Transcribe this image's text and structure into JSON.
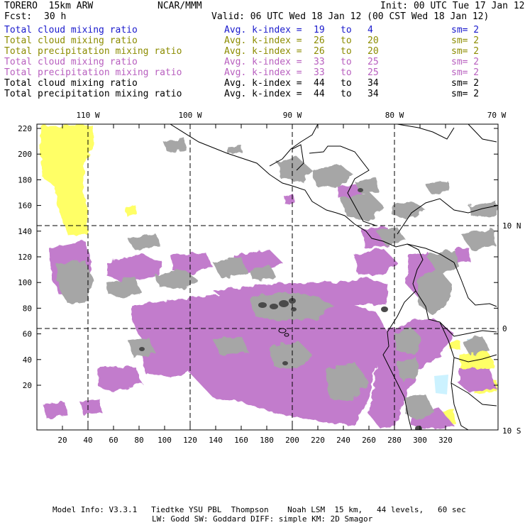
{
  "header": {
    "model": "TORERO  15km ARW",
    "org": "NCAR/MMM",
    "init": "Init: 00 UTC Tue 17 Jan 12",
    "fcst_label": "Fcst:",
    "fcst_value": "30 h",
    "valid": "Valid: 06 UTC Wed 18 Jan 12 (00 CST Wed 18 Jan 12)"
  },
  "legend": [
    {
      "field": "Total cloud mixing ratio",
      "kidx": "Avg. k-index =",
      "hi": "19",
      "to": "to",
      "lo": "4",
      "sm": "sm= 2",
      "color": "#1a1acc"
    },
    {
      "field": "Total cloud mixing ratio",
      "kidx": "Avg. k-index =",
      "hi": "26",
      "to": "to",
      "lo": "20",
      "sm": "sm= 2",
      "color": "#8c8c00"
    },
    {
      "field": "Total precipitation mixing ratio",
      "kidx": "Avg. k-index =",
      "hi": "26",
      "to": "to",
      "lo": "20",
      "sm": "sm= 2",
      "color": "#8c8c00"
    },
    {
      "field": "Total cloud mixing ratio",
      "kidx": "Avg. k-index =",
      "hi": "33",
      "to": "to",
      "lo": "25",
      "sm": "sm= 2",
      "color": "#b85fbf"
    },
    {
      "field": "Total precipitation mixing ratio",
      "kidx": "Avg. k-index =",
      "hi": "33",
      "to": "to",
      "lo": "25",
      "sm": "sm= 2",
      "color": "#b85fbf"
    },
    {
      "field": "Total cloud mixing ratio",
      "kidx": "Avg. k-index =",
      "hi": "44",
      "to": "to",
      "lo": "34",
      "sm": "sm= 2",
      "color": "#000000"
    },
    {
      "field": "Total precipitation mixing ratio",
      "kidx": "Avg. k-index =",
      "hi": "44",
      "to": "to",
      "lo": "34",
      "sm": "sm= 2",
      "color": "#000000"
    }
  ],
  "map": {
    "lon_labels": [
      "110 W",
      "100 W",
      "90 W",
      "80 W",
      "70 W"
    ],
    "lat_labels": [
      "10 N",
      "0",
      "10 S"
    ],
    "y_ticks": [
      "220",
      "200",
      "180",
      "160",
      "140",
      "120",
      "100",
      "80",
      "60",
      "40",
      "20"
    ],
    "x_ticks": [
      "20",
      "40",
      "60",
      "80",
      "100",
      "120",
      "140",
      "160",
      "180",
      "200",
      "220",
      "240",
      "260",
      "280",
      "300",
      "320"
    ],
    "colors": {
      "gray": "#a6a6a6",
      "dark_gray": "#4a4a4a",
      "magenta": "#c27ccc",
      "yellow": "#ffff66",
      "light_blue": "#ccf2ff",
      "coast": "#000000"
    }
  },
  "footer": {
    "line1": "Model Info: V3.3.1   Tiedtke YSU PBL  Thompson    Noah LSM  15 km,   44 levels,   60 sec",
    "line2": "LW: Godd SW: Goddard DIFF: simple KM: 2D Smagor"
  }
}
